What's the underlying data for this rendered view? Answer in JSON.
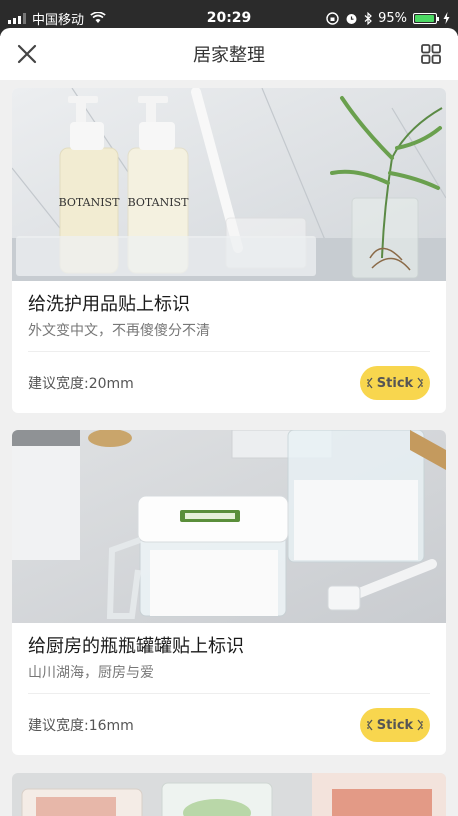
{
  "status_bar": {
    "carrier": "中国移动",
    "time": "20:29",
    "battery_percent": "95%",
    "battery_level": 0.95
  },
  "nav": {
    "title": "居家整理",
    "close_icon": "close-icon",
    "menu_icon": "grid-icon"
  },
  "cards": [
    {
      "title": "给洗护用品贴上标识",
      "subtitle": "外文变中文，不再傻傻分不清",
      "width_text": "建议宽度:20mm",
      "button_label": "Stick",
      "bottle_label": "BOTANIST",
      "image": "bathroom-bottles-photo"
    },
    {
      "title": "给厨房的瓶瓶罐罐贴上标识",
      "subtitle": "山川湖海，厨房与爱",
      "width_text": "建议宽度:16mm",
      "button_label": "Stick",
      "image": "kitchen-containers-photo"
    },
    {
      "image": "food-bags-photo"
    }
  ],
  "colors": {
    "accent": "#f8d64e",
    "background": "#f0f0f0",
    "status_bar": "#2b2b2b"
  }
}
